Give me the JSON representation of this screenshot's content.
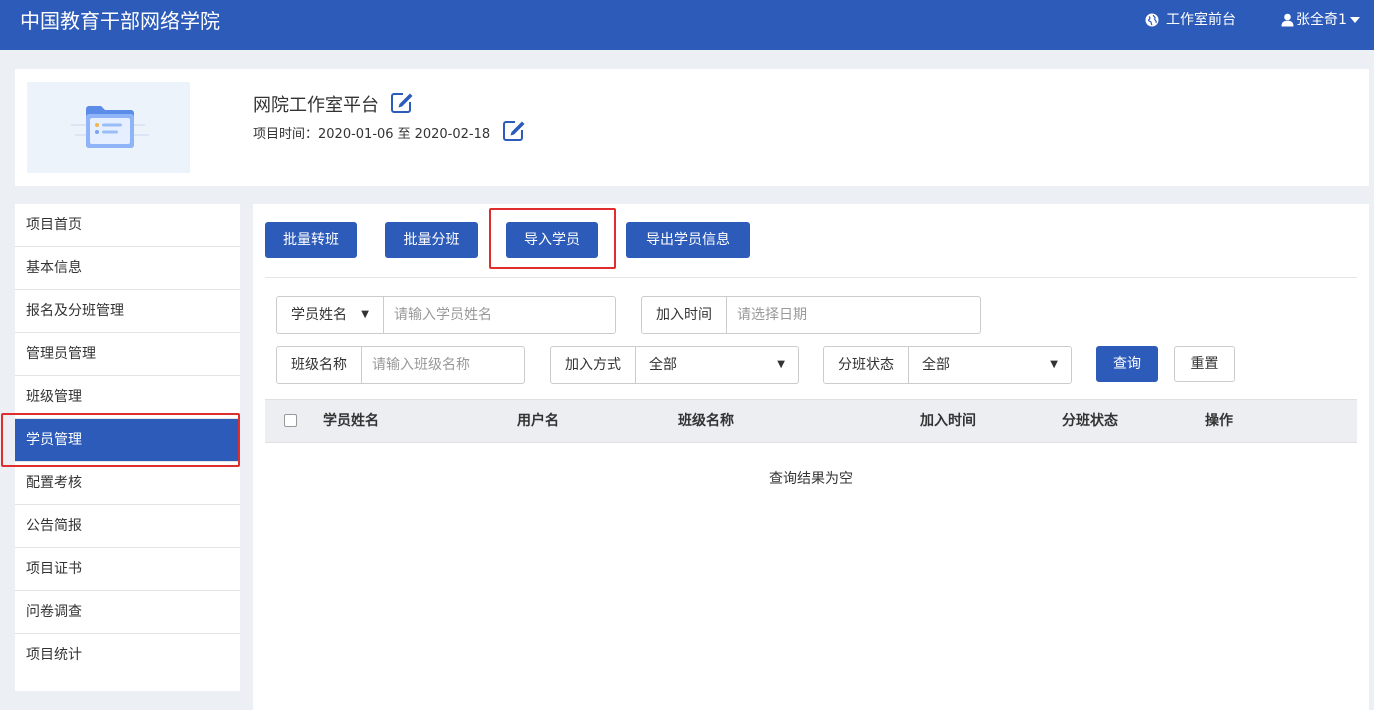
{
  "header": {
    "brand": "中国教育干部网络学院",
    "frontend_link": "工作室前台",
    "user_name": "张全奇1"
  },
  "project": {
    "title": "网院工作室平台",
    "time_label": "项目时间：",
    "start_date": "2020-01-06",
    "date_sep": "至",
    "end_date": "2020-02-18"
  },
  "sidebar": {
    "items": [
      {
        "label": "项目首页"
      },
      {
        "label": "基本信息"
      },
      {
        "label": "报名及分班管理"
      },
      {
        "label": "管理员管理"
      },
      {
        "label": "班级管理"
      },
      {
        "label": "学员管理"
      },
      {
        "label": "配置考核"
      },
      {
        "label": "公告简报"
      },
      {
        "label": "项目证书"
      },
      {
        "label": "问卷调查"
      },
      {
        "label": "项目统计"
      }
    ],
    "active_item": "学员管理"
  },
  "toolbar": {
    "batch_transfer": "批量转班",
    "batch_assign": "批量分班",
    "import_students": "导入学员",
    "export_students": "导出学员信息"
  },
  "filters": {
    "name_type": "学员姓名",
    "name_placeholder": "请输入学员姓名",
    "join_time_label": "加入时间",
    "join_time_placeholder": "请选择日期",
    "class_name_label": "班级名称",
    "class_name_placeholder": "请输入班级名称",
    "join_method_label": "加入方式",
    "join_method_value": "全部",
    "assign_status_label": "分班状态",
    "assign_status_value": "全部",
    "query": "查询",
    "reset": "重置"
  },
  "table": {
    "columns": [
      "学员姓名",
      "用户名",
      "班级名称",
      "加入时间",
      "分班状态",
      "操作"
    ],
    "empty_text": "查询结果为空"
  },
  "colors": {
    "primary": "#2d5bb9",
    "highlight": "#e02e2e"
  }
}
